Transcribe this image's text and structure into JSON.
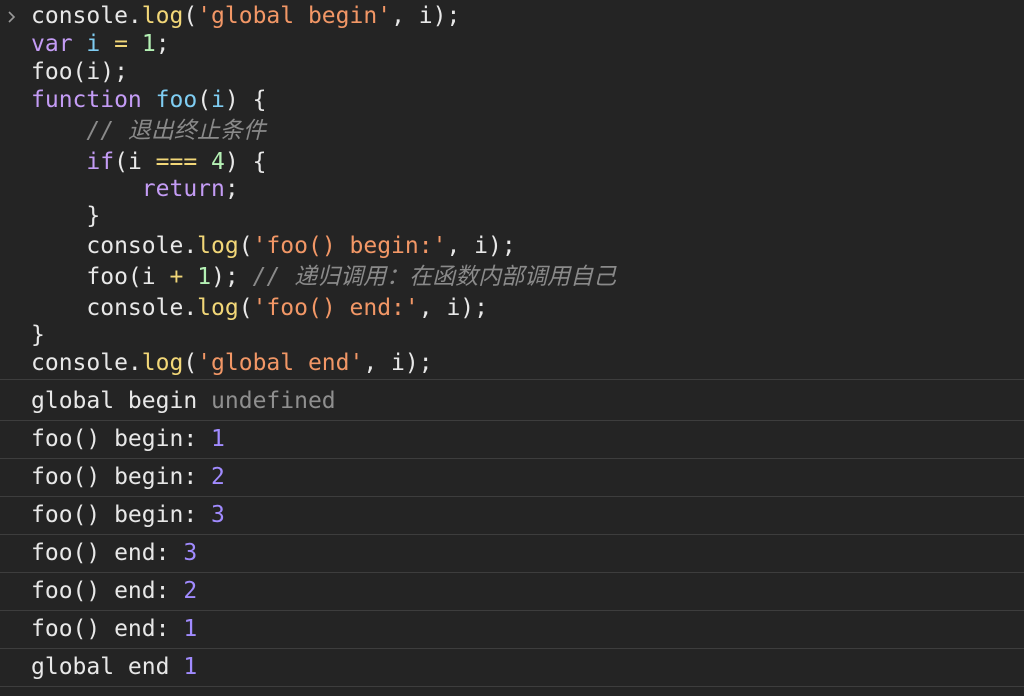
{
  "input": {
    "prompt_icon": "chevron-right-icon",
    "lines": [
      [
        {
          "cls": "t-plain",
          "text": "console."
        },
        {
          "cls": "t-fn",
          "text": "log"
        },
        {
          "cls": "t-plain",
          "text": "("
        },
        {
          "cls": "t-str",
          "text": "'global begin'"
        },
        {
          "cls": "t-plain",
          "text": ", i);"
        }
      ],
      [
        {
          "cls": "t-kw",
          "text": "var"
        },
        {
          "cls": "t-plain",
          "text": " "
        },
        {
          "cls": "t-var",
          "text": "i"
        },
        {
          "cls": "t-plain",
          "text": " "
        },
        {
          "cls": "t-op",
          "text": "="
        },
        {
          "cls": "t-plain",
          "text": " "
        },
        {
          "cls": "t-num",
          "text": "1"
        },
        {
          "cls": "t-plain",
          "text": ";"
        }
      ],
      [
        {
          "cls": "t-plain",
          "text": "foo(i);"
        }
      ],
      [
        {
          "cls": "t-kw",
          "text": "function"
        },
        {
          "cls": "t-plain",
          "text": " "
        },
        {
          "cls": "t-var",
          "text": "foo"
        },
        {
          "cls": "t-plain",
          "text": "("
        },
        {
          "cls": "t-var",
          "text": "i"
        },
        {
          "cls": "t-plain",
          "text": ") {"
        }
      ],
      [
        {
          "cls": "t-plain",
          "text": "    "
        },
        {
          "cls": "t-comment",
          "text": "// 退出终止条件"
        }
      ],
      [
        {
          "cls": "t-plain",
          "text": "    "
        },
        {
          "cls": "t-kw",
          "text": "if"
        },
        {
          "cls": "t-plain",
          "text": "(i "
        },
        {
          "cls": "t-op",
          "text": "==="
        },
        {
          "cls": "t-plain",
          "text": " "
        },
        {
          "cls": "t-num",
          "text": "4"
        },
        {
          "cls": "t-plain",
          "text": ") {"
        }
      ],
      [
        {
          "cls": "t-plain",
          "text": "        "
        },
        {
          "cls": "t-kw",
          "text": "return"
        },
        {
          "cls": "t-plain",
          "text": ";"
        }
      ],
      [
        {
          "cls": "t-plain",
          "text": "    }"
        }
      ],
      [
        {
          "cls": "t-plain",
          "text": "    console."
        },
        {
          "cls": "t-fn",
          "text": "log"
        },
        {
          "cls": "t-plain",
          "text": "("
        },
        {
          "cls": "t-str",
          "text": "'foo() begin:'"
        },
        {
          "cls": "t-plain",
          "text": ", i);"
        }
      ],
      [
        {
          "cls": "t-plain",
          "text": "    foo(i "
        },
        {
          "cls": "t-op",
          "text": "+"
        },
        {
          "cls": "t-plain",
          "text": " "
        },
        {
          "cls": "t-num",
          "text": "1"
        },
        {
          "cls": "t-plain",
          "text": "); "
        },
        {
          "cls": "t-comment",
          "text": "// 递归调用：在函数内部调用自己"
        }
      ],
      [
        {
          "cls": "t-plain",
          "text": "    console."
        },
        {
          "cls": "t-fn",
          "text": "log"
        },
        {
          "cls": "t-plain",
          "text": "("
        },
        {
          "cls": "t-str",
          "text": "'foo() end:'"
        },
        {
          "cls": "t-plain",
          "text": ", i);"
        }
      ],
      [
        {
          "cls": "t-plain",
          "text": "}"
        }
      ],
      [
        {
          "cls": "t-plain",
          "text": "console."
        },
        {
          "cls": "t-fn",
          "text": "log"
        },
        {
          "cls": "t-plain",
          "text": "("
        },
        {
          "cls": "t-str",
          "text": "'global end'"
        },
        {
          "cls": "t-plain",
          "text": ", i);"
        }
      ]
    ]
  },
  "output": [
    {
      "label": "global begin",
      "value": "undefined",
      "value_type": "undefined"
    },
    {
      "label": "foo() begin:",
      "value": "1",
      "value_type": "number"
    },
    {
      "label": "foo() begin:",
      "value": "2",
      "value_type": "number"
    },
    {
      "label": "foo() begin:",
      "value": "3",
      "value_type": "number"
    },
    {
      "label": "foo() end:",
      "value": "3",
      "value_type": "number"
    },
    {
      "label": "foo() end:",
      "value": "2",
      "value_type": "number"
    },
    {
      "label": "foo() end:",
      "value": "1",
      "value_type": "number"
    },
    {
      "label": "global end",
      "value": "1",
      "value_type": "number"
    }
  ],
  "colors": {
    "background": "#242424",
    "divider": "#3d3d3d",
    "keyword": "#c49cf5",
    "function_call": "#f2d778",
    "string": "#f29766",
    "number_literal": "#b4f0b4",
    "identifier": "#7fcdf2",
    "comment": "#8a8a8a",
    "output_number": "#a18bff",
    "output_undefined": "#8f8f8f"
  }
}
